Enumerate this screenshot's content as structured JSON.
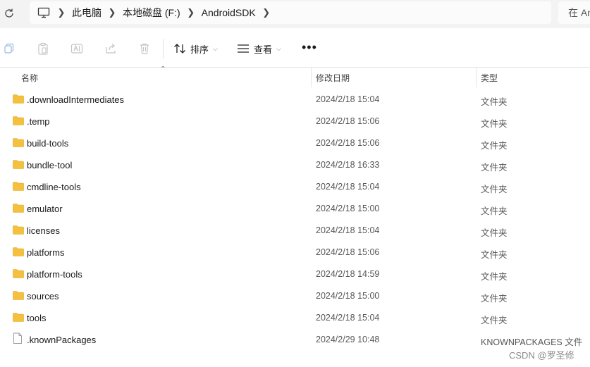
{
  "address_bar": {
    "crumbs": [
      "此电脑",
      "本地磁盘 (F:)",
      "AndroidSDK"
    ],
    "search_placeholder": "在 An"
  },
  "toolbar": {
    "sort_label": "排序",
    "view_label": "查看",
    "more_label": "•••"
  },
  "columns": {
    "name": "名称",
    "modified": "修改日期",
    "type": "类型"
  },
  "files": [
    {
      "name": ".downloadIntermediates",
      "modified": "2024/2/18 15:04",
      "type": "文件夹",
      "kind": "folder"
    },
    {
      "name": ".temp",
      "modified": "2024/2/18 15:06",
      "type": "文件夹",
      "kind": "folder"
    },
    {
      "name": "build-tools",
      "modified": "2024/2/18 15:06",
      "type": "文件夹",
      "kind": "folder"
    },
    {
      "name": "bundle-tool",
      "modified": "2024/2/18 16:33",
      "type": "文件夹",
      "kind": "folder"
    },
    {
      "name": "cmdline-tools",
      "modified": "2024/2/18 15:04",
      "type": "文件夹",
      "kind": "folder"
    },
    {
      "name": "emulator",
      "modified": "2024/2/18 15:00",
      "type": "文件夹",
      "kind": "folder"
    },
    {
      "name": "licenses",
      "modified": "2024/2/18 15:04",
      "type": "文件夹",
      "kind": "folder"
    },
    {
      "name": "platforms",
      "modified": "2024/2/18 15:06",
      "type": "文件夹",
      "kind": "folder"
    },
    {
      "name": "platform-tools",
      "modified": "2024/2/18 14:59",
      "type": "文件夹",
      "kind": "folder"
    },
    {
      "name": "sources",
      "modified": "2024/2/18 15:00",
      "type": "文件夹",
      "kind": "folder"
    },
    {
      "name": "tools",
      "modified": "2024/2/18 15:04",
      "type": "文件夹",
      "kind": "folder"
    },
    {
      "name": ".knownPackages",
      "modified": "2024/2/29 10:48",
      "type": "KNOWNPACKAGES 文件",
      "kind": "file"
    }
  ],
  "watermark": "CSDN @罗圣修",
  "colors": {
    "folder": "#f4c03e",
    "folder_dark": "#e6a817",
    "accent": "#0067c0"
  }
}
